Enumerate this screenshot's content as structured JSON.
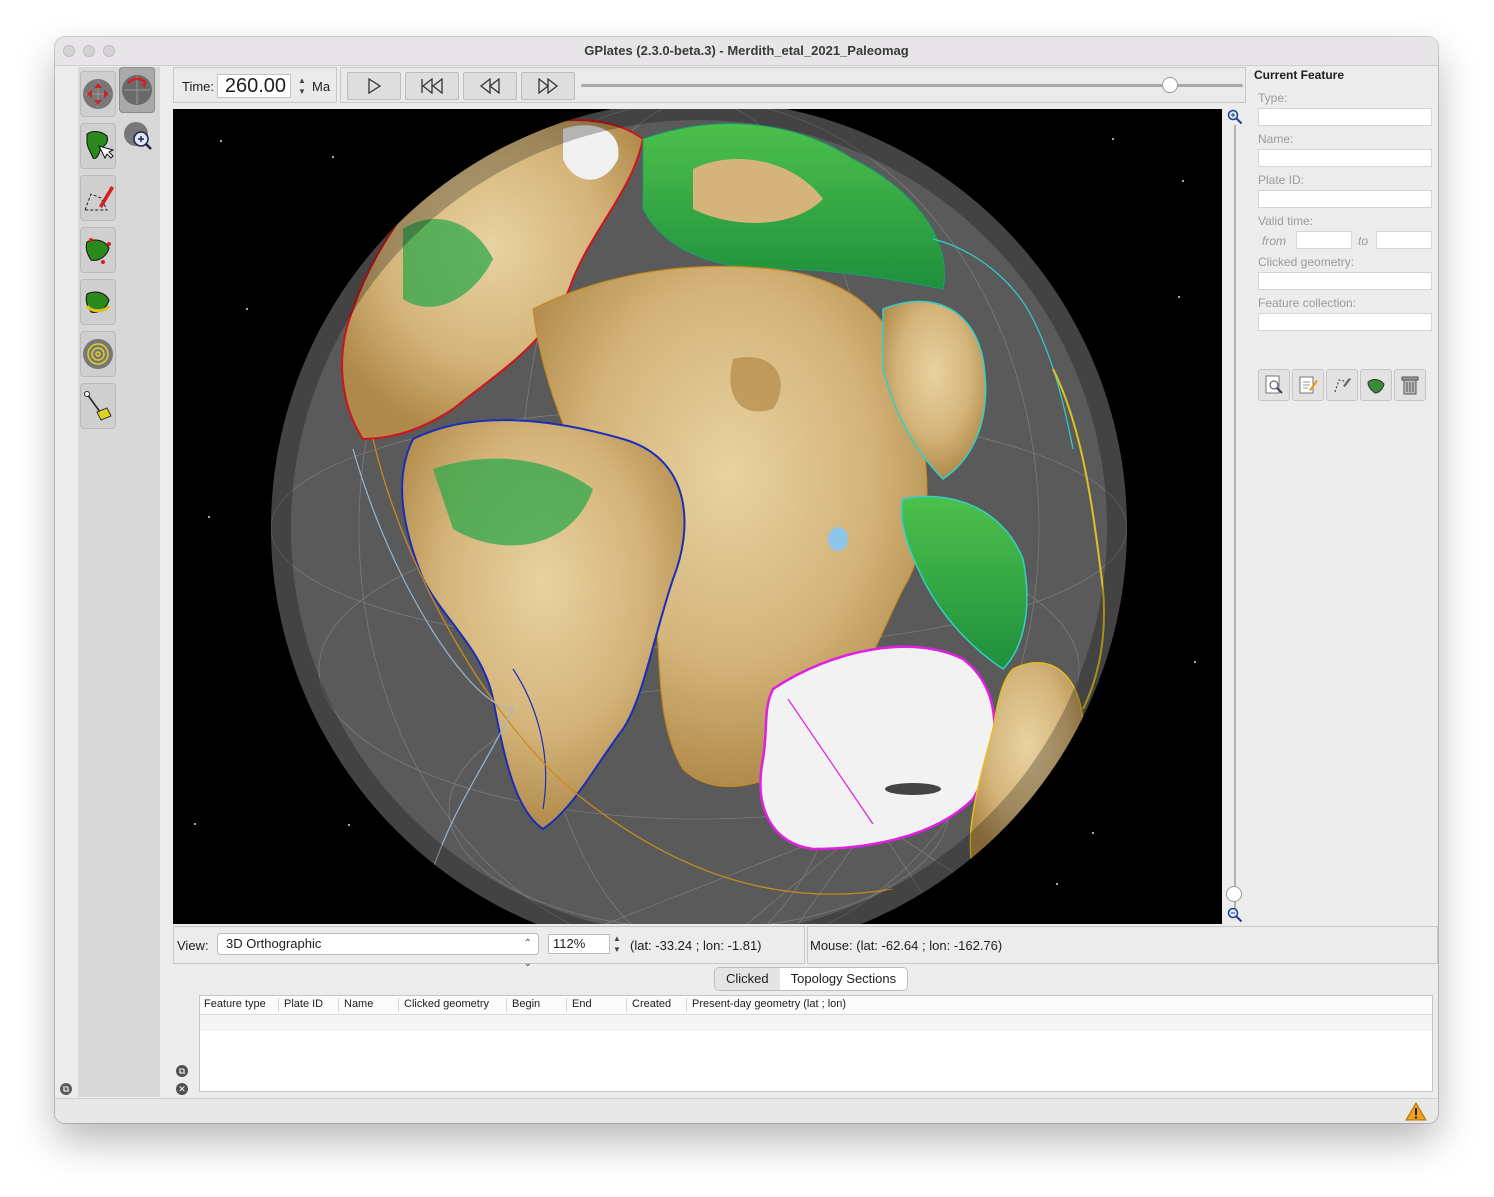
{
  "window": {
    "title": "GPlates (2.3.0-beta.3) - Merdith_etal_2021_Paleomag"
  },
  "time": {
    "label": "Time:",
    "value": "260.00",
    "unit": "Ma"
  },
  "playback": {
    "buttons": [
      "play-icon",
      "rewind-to-start-icon",
      "step-back-icon",
      "step-forward-icon"
    ],
    "slider_position": 0.89
  },
  "tools": [
    "drag-globe-tool",
    "rotate-globe-tool",
    "choose-feature-tool",
    "zoom-tool",
    "digitise-geometry-tool",
    "topology-tool",
    "move-pole-tool",
    "small-circle-tool",
    "measure-distance-tool"
  ],
  "globe": {
    "ocean_color": "#5a5a5a",
    "space_color": "#000000",
    "boundary_colors": {
      "north_america": "#d0141a",
      "south_america": "#1a2fb8",
      "antarctica": "#e020e0",
      "tethys": "#30d0c8",
      "subduction": "#e0c020"
    },
    "zoom_slider_position": 0.98
  },
  "view": {
    "label": "View:",
    "projection": "3D Orthographic",
    "zoom": "112%",
    "camera_coords": "(lat: -33.24 ; lon: -1.81)"
  },
  "mouse": {
    "text": "Mouse: (lat: -62.64 ; lon: -162.76)"
  },
  "bottom_panel": {
    "tabs": [
      {
        "label": "Clicked",
        "active": true
      },
      {
        "label": "Topology Sections",
        "active": false
      }
    ],
    "columns": [
      "Feature type",
      "Plate ID",
      "Name",
      "Clicked geometry",
      "Begin",
      "End",
      "Created",
      "Present-day geometry (lat ; lon)"
    ]
  },
  "feature_panel": {
    "title": "Current Feature",
    "fields": {
      "type": "Type:",
      "name": "Name:",
      "plate_id": "Plate ID:",
      "valid_time": "Valid time:",
      "from": "from",
      "to": "to",
      "clicked_geometry": "Clicked geometry:",
      "feature_collection": "Feature collection:"
    },
    "buttons": [
      "query-feature-icon",
      "edit-feature-icon",
      "edit-geometry-icon",
      "clone-feature-icon",
      "delete-feature-icon"
    ]
  },
  "status": {
    "warning_icon": "warning-icon"
  }
}
